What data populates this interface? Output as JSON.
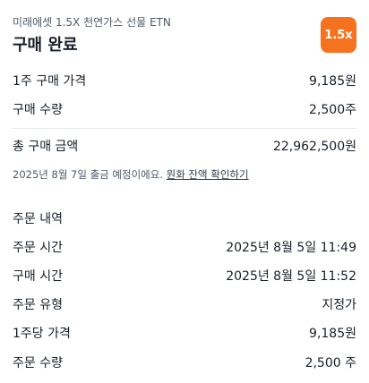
{
  "header": {
    "subtitle": "미래에셋 1.5X 천연가스 선물 ETN",
    "title": "구매 완료",
    "badge": "1.5x",
    "badge_color": "#f5731e"
  },
  "purchase": {
    "price_label": "1주 구매 가격",
    "price_value": "9,185원",
    "qty_label": "구매 수량",
    "qty_value": "2,500주",
    "total_label": "총 구매 금액",
    "total_value": "22,962,500원"
  },
  "notice": {
    "text": "2025년 8월 7일 출금 예정이에요.",
    "link": "원화 잔액 확인하기"
  },
  "order": {
    "section_title": "주문 내역",
    "rows": [
      {
        "label": "주문 시간",
        "value": "2025년 8월 5일 11:49"
      },
      {
        "label": "구매 시간",
        "value": "2025년 8월 5일 11:52"
      },
      {
        "label": "주문 유형",
        "value": "지정가"
      },
      {
        "label": "1주당 가격",
        "value": "9,185원"
      },
      {
        "label": "주문 수량",
        "value": "2,500 주"
      }
    ]
  }
}
